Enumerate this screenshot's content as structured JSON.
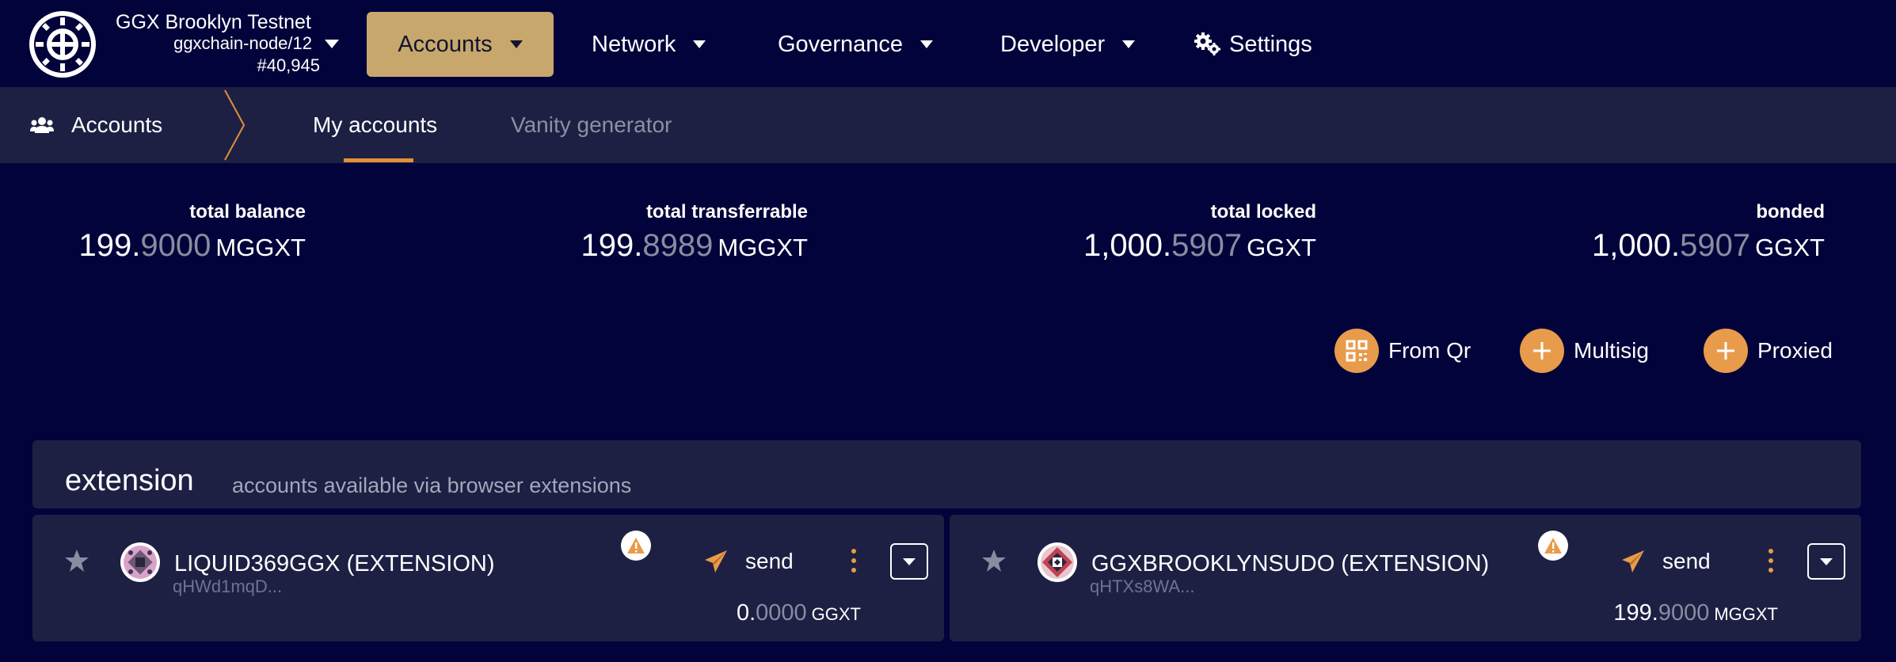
{
  "chain": {
    "name": "GGX Brooklyn Testnet",
    "node": "ggxchain-node/12",
    "block": "#40,945"
  },
  "nav": {
    "accounts": "Accounts",
    "network": "Network",
    "governance": "Governance",
    "developer": "Developer",
    "settings": "Settings"
  },
  "subnav": {
    "home": "Accounts",
    "tabs": [
      {
        "label": "My accounts",
        "active": true
      },
      {
        "label": "Vanity generator",
        "active": false
      }
    ]
  },
  "summary": [
    {
      "label": "total balance",
      "int": "199.",
      "dec": "9000",
      "unit": "MGGXT"
    },
    {
      "label": "total transferrable",
      "int": "199.",
      "dec": "8989",
      "unit": "MGGXT"
    },
    {
      "label": "total locked",
      "int": "1,000.",
      "dec": "5907",
      "unit": "GGXT"
    },
    {
      "label": "bonded",
      "int": "1,000.",
      "dec": "5907",
      "unit": "GGXT"
    }
  ],
  "actions": {
    "from_qr": "From Qr",
    "multisig": "Multisig",
    "proxied": "Proxied"
  },
  "section": {
    "title": "extension",
    "description": "accounts available via browser extensions"
  },
  "accounts": [
    {
      "name": "LIQUID369GGX (EXTENSION)",
      "address": "qHWd1mqD...",
      "send": "send",
      "bal_int": "0.",
      "bal_dec": "0000",
      "unit": "GGXT"
    },
    {
      "name": "GGXBROOKLYNSUDO (EXTENSION)",
      "address": "qHTXs8WA...",
      "send": "send",
      "bal_int": "199.",
      "bal_dec": "9000",
      "unit": "MGGXT"
    }
  ],
  "colors": {
    "background": "#02033a",
    "panel": "#1d2043",
    "accent": "#c7a76c",
    "orange": "#e89b4a"
  }
}
